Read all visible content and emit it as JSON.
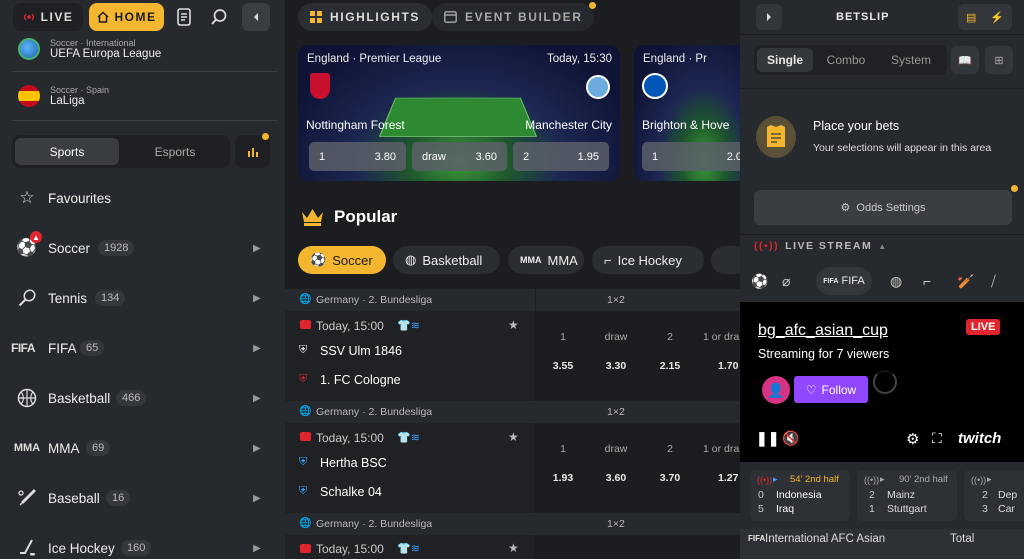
{
  "topnav": {
    "live": "LIVE",
    "home": "HOME"
  },
  "sidebar": {
    "leagues": [
      {
        "sub": "Soccer · International",
        "name": "UEFA Europa League"
      },
      {
        "sub": "Soccer · Spain",
        "name": "LaLiga"
      }
    ],
    "toggle": {
      "sports": "Sports",
      "esports": "Esports"
    },
    "items": [
      {
        "label": "Favourites",
        "count": ""
      },
      {
        "label": "Soccer",
        "count": "1928"
      },
      {
        "label": "Tennis",
        "count": "134"
      },
      {
        "label": "FIFA",
        "count": "65"
      },
      {
        "label": "Basketball",
        "count": "466"
      },
      {
        "label": "MMA",
        "count": "69"
      },
      {
        "label": "Baseball",
        "count": "16"
      },
      {
        "label": "Ice Hockey",
        "count": "160"
      }
    ]
  },
  "main": {
    "tabs": {
      "highlights": "HIGHLIGHTS",
      "event_builder": "EVENT BUILDER"
    },
    "highlights": [
      {
        "league": "England · Premier League",
        "time": "Today, 15:30",
        "home": "Nottingham Forest",
        "away": "Manchester City",
        "odds": [
          {
            "l": "1",
            "v": "3.80"
          },
          {
            "l": "draw",
            "v": "3.60"
          },
          {
            "l": "2",
            "v": "1.95"
          }
        ]
      },
      {
        "league": "England · Pr",
        "home": "Brighton & Hove",
        "odds": [
          {
            "l": "1",
            "v": "2.0"
          }
        ]
      }
    ],
    "popular_title": "Popular",
    "sport_chips": [
      "Soccer",
      "Basketball",
      "MMA",
      "Ice Hockey"
    ],
    "matches": [
      {
        "league": "Germany · 2. Bundesliga",
        "market": "1×2",
        "time": "Today, 15:00",
        "home": "SSV Ulm 1846",
        "away": "1. FC Cologne",
        "labels": [
          "1",
          "draw",
          "2",
          "1 or dra"
        ],
        "odds": [
          "3.55",
          "3.30",
          "2.15",
          "1.70"
        ]
      },
      {
        "league": "Germany · 2. Bundesliga",
        "market": "1×2",
        "time": "Today, 15:00",
        "home": "Hertha BSC",
        "away": "Schalke 04",
        "labels": [
          "1",
          "draw",
          "2",
          "1 or dra"
        ],
        "odds": [
          "1.93",
          "3.60",
          "3.70",
          "1.27"
        ]
      },
      {
        "league": "Germany · 2. Bundesliga",
        "market": "1×2",
        "time": "Today, 15:00"
      }
    ]
  },
  "betslip": {
    "title": "BETSLIP",
    "tabs": [
      "Single",
      "Combo",
      "System"
    ],
    "empty_title": "Place your bets",
    "empty_sub": "Your selections will appear in this area",
    "odds_settings": "Odds Settings",
    "live_stream": "LIVE STREAM",
    "stream_tab_fifa": "FIFA",
    "stream": {
      "channel": "bg_afc_asian_cup",
      "viewers": "Streaming for 7 viewers",
      "live": "LIVE",
      "follow": "Follow",
      "brand": "twitch"
    },
    "live_matches": [
      {
        "time": "54' 2nd half",
        "s1": "0",
        "t1": "Indonesia",
        "s2": "5",
        "t2": "Iraq"
      },
      {
        "time": "90' 2nd half",
        "s1": "2",
        "t1": "Mainz",
        "s2": "1",
        "t2": "Stuttgart"
      },
      {
        "time": "",
        "s1": "2",
        "t1": "Dep",
        "s2": "3",
        "t2": "Car"
      }
    ],
    "bottom_league": "International AFC Asian",
    "bottom_total": "Total"
  },
  "colors": {
    "accent": "#f4b52f",
    "live_red": "#e0252f",
    "twitch_purple": "#9146ff"
  }
}
